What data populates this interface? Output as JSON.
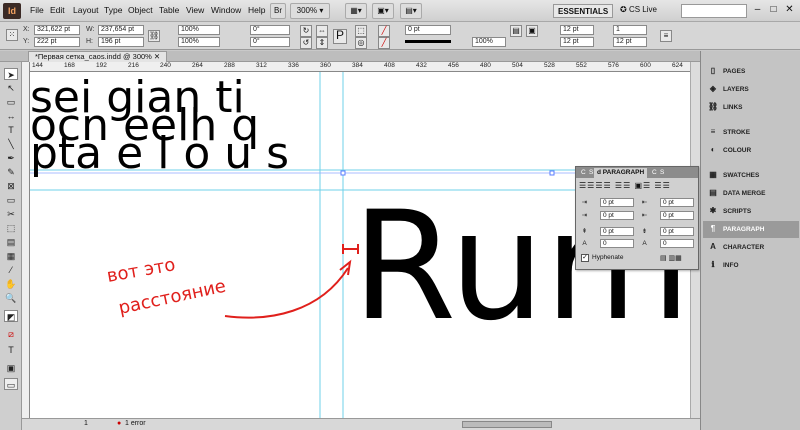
{
  "app": {
    "logo": "Id"
  },
  "menu": [
    "File",
    "Edit",
    "Layout",
    "Type",
    "Object",
    "Table",
    "View",
    "Window",
    "Help"
  ],
  "zoom": "300%",
  "workspace": "ESSENTIALS",
  "cs_live": "CS Live",
  "control": {
    "x": "321,622 pt",
    "y": "222 pt",
    "w": "237,654 pt",
    "h": "196 pt",
    "scale_x": "100%",
    "scale_y": "100%",
    "rotate": "0°",
    "shear": "0°",
    "stroke_weight": "0 pt",
    "opacity": "100%",
    "col_w": "12 pt",
    "gutter_w": "12 pt",
    "cols": "1",
    "x_label": "X:",
    "y_label": "Y:",
    "w_label": "W:",
    "h_label": "H:"
  },
  "doc_tab": "*Первая сетка_caos.indd @ 300%",
  "ruler": [
    "144",
    "168",
    "192",
    "216",
    "240",
    "264",
    "288",
    "312",
    "336",
    "360",
    "384",
    "408",
    "432",
    "456",
    "480",
    "504",
    "528",
    "552",
    "576",
    "600",
    "624"
  ],
  "canvas_text": {
    "top_line1": "sei gian ti",
    "top_line2": "ocn eelh q",
    "top_line3": "pta e l o u s",
    "big": "Rum",
    "annotation1": "вот это",
    "annotation2": "расстояние"
  },
  "paragraph_panel": {
    "tabs": [
      "C",
      "S",
      "d PARAGRAPH",
      "C",
      "S"
    ],
    "fields": [
      "0 pt",
      "0 pt",
      "0 pt",
      "0 pt",
      "0 pt",
      "0 pt",
      "0",
      "0"
    ],
    "hyphenate": "Hyphenate"
  },
  "dock": [
    "PAGES",
    "LAYERS",
    "LINKS",
    "STROKE",
    "COLOUR",
    "SWATCHES",
    "DATA MERGE",
    "SCRIPTS",
    "PARAGRAPH",
    "CHARACTER",
    "INFO"
  ],
  "status": {
    "page": "1",
    "errors": "1 error"
  }
}
